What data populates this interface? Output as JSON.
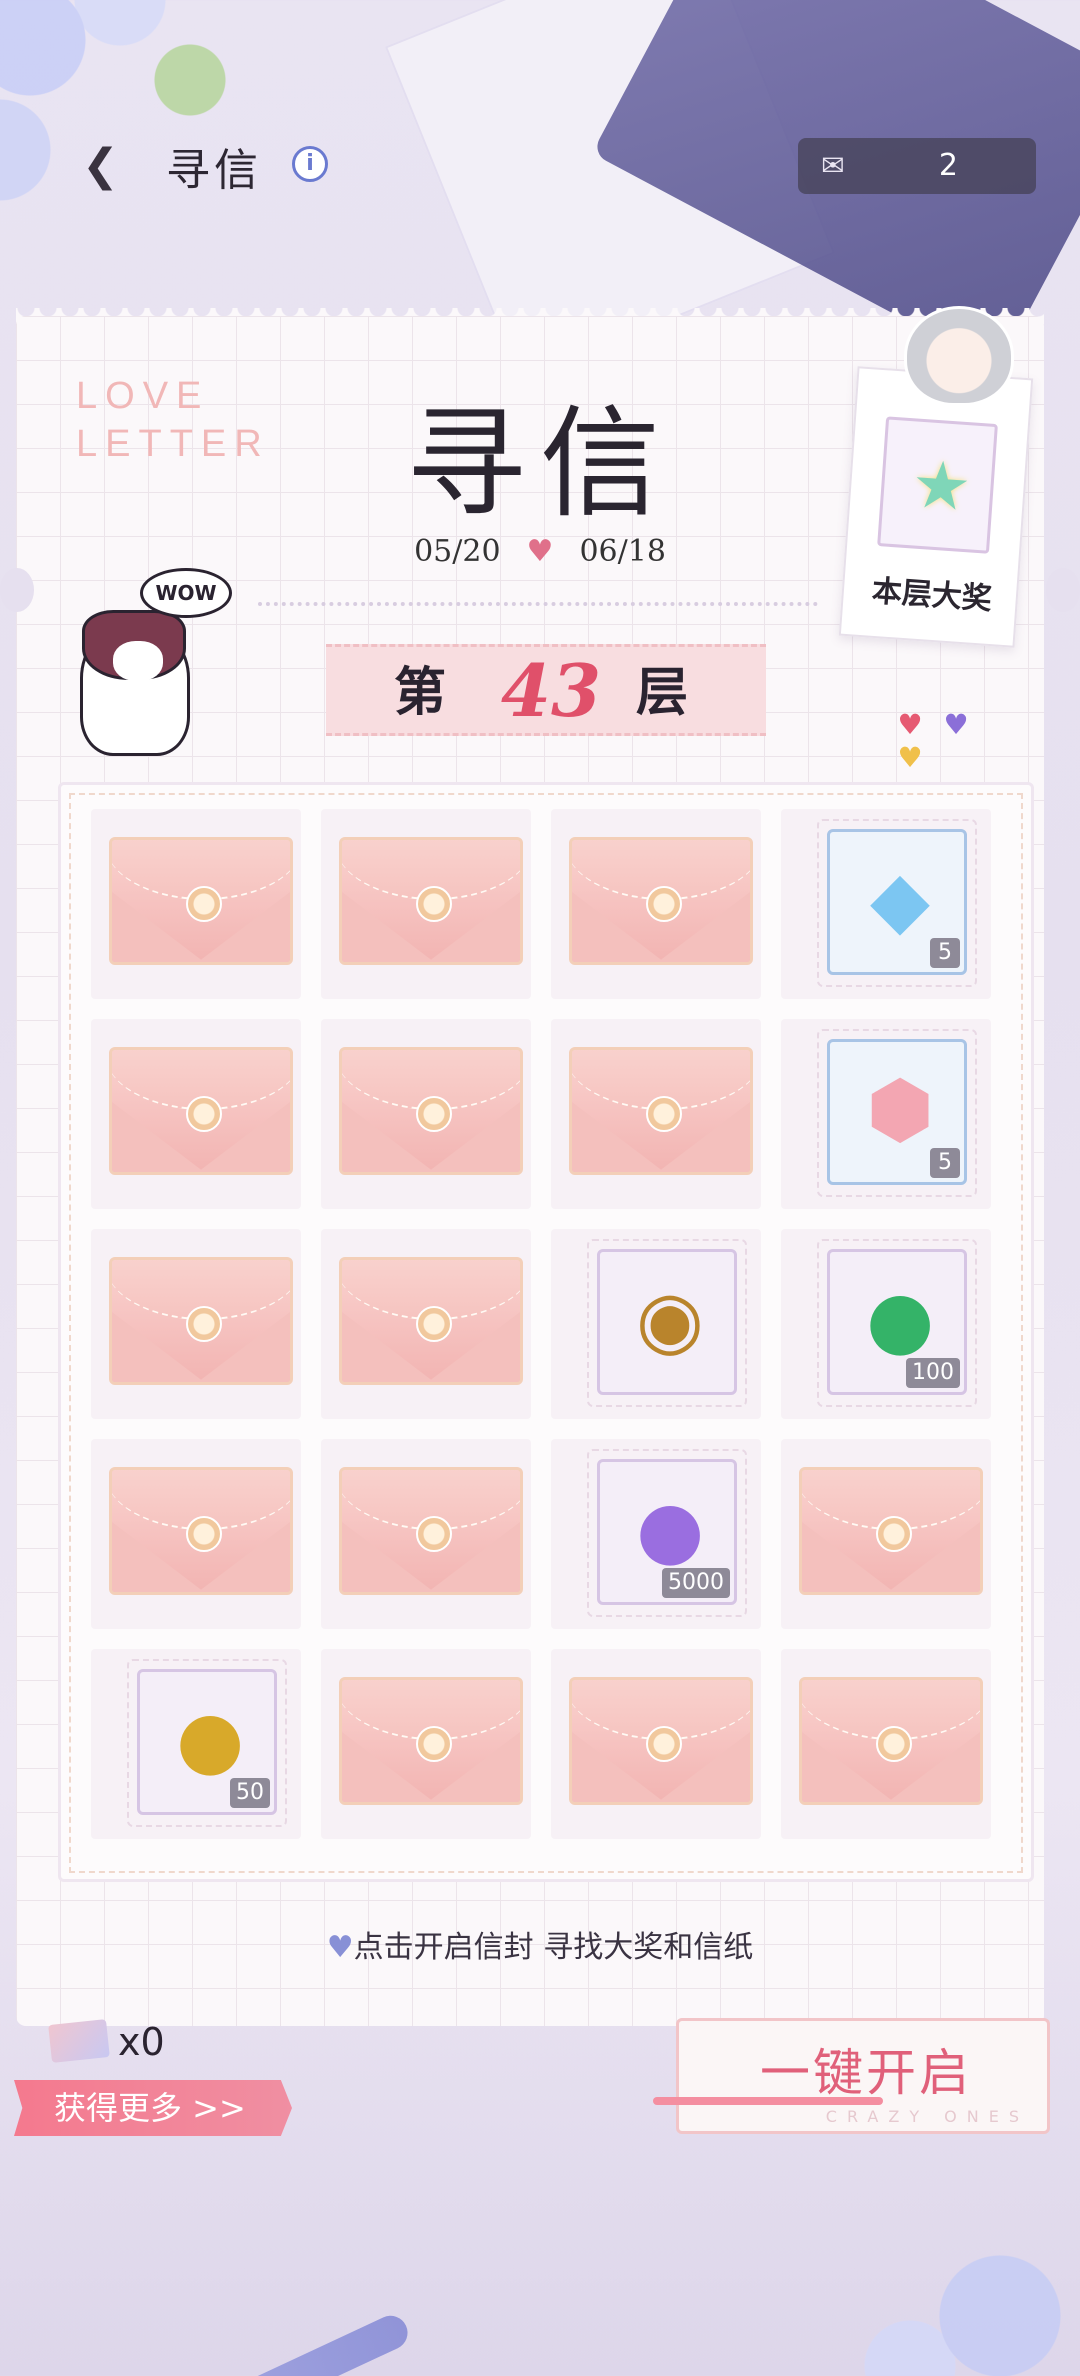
{
  "header": {
    "back_icon": "chevron-left-icon",
    "title": "寻信",
    "info_icon_text": "i",
    "ticket_count": "2"
  },
  "card": {
    "deco_text_line1": "LOVE",
    "deco_text_line2": "LETTER",
    "big_title": "寻信",
    "date_start": "05/20",
    "date_end": "06/18",
    "cat_bubble": "WOW",
    "floor_prefix": "第",
    "floor_number": "43",
    "floor_suffix": "层",
    "grand_prize_label": "本层大奖",
    "heart_colors": [
      "#e65a72",
      "#8b6fd8",
      "#f0c04a"
    ]
  },
  "grid": {
    "rows": [
      [
        {
          "type": "envelope"
        },
        {
          "type": "envelope"
        },
        {
          "type": "envelope"
        },
        {
          "type": "reward",
          "style": "blue",
          "icon": "crystal-icon",
          "count": "5"
        }
      ],
      [
        {
          "type": "envelope"
        },
        {
          "type": "envelope"
        },
        {
          "type": "envelope"
        },
        {
          "type": "reward",
          "style": "blue",
          "icon": "character-shard-icon",
          "count": "5"
        }
      ],
      [
        {
          "type": "envelope"
        },
        {
          "type": "envelope"
        },
        {
          "type": "reward",
          "style": "purple",
          "icon": "gold-emblem-icon",
          "count": ""
        },
        {
          "type": "reward",
          "style": "purple",
          "icon": "green-coin-icon",
          "count": "100"
        }
      ],
      [
        {
          "type": "envelope"
        },
        {
          "type": "envelope"
        },
        {
          "type": "reward",
          "style": "purple",
          "icon": "purple-coin-icon",
          "count": "5000"
        },
        {
          "type": "envelope"
        }
      ],
      [
        {
          "type": "reward",
          "style": "purple",
          "icon": "vs-coin-icon",
          "count": "50"
        },
        {
          "type": "envelope"
        },
        {
          "type": "envelope"
        },
        {
          "type": "envelope"
        }
      ]
    ]
  },
  "hint_text": "点击开启信封 寻找大奖和信纸",
  "bottom": {
    "letter_count": "x0",
    "get_more_label": "获得更多 >>",
    "open_all_label": "一键开启",
    "open_all_sub": "CRAZY ONES"
  }
}
